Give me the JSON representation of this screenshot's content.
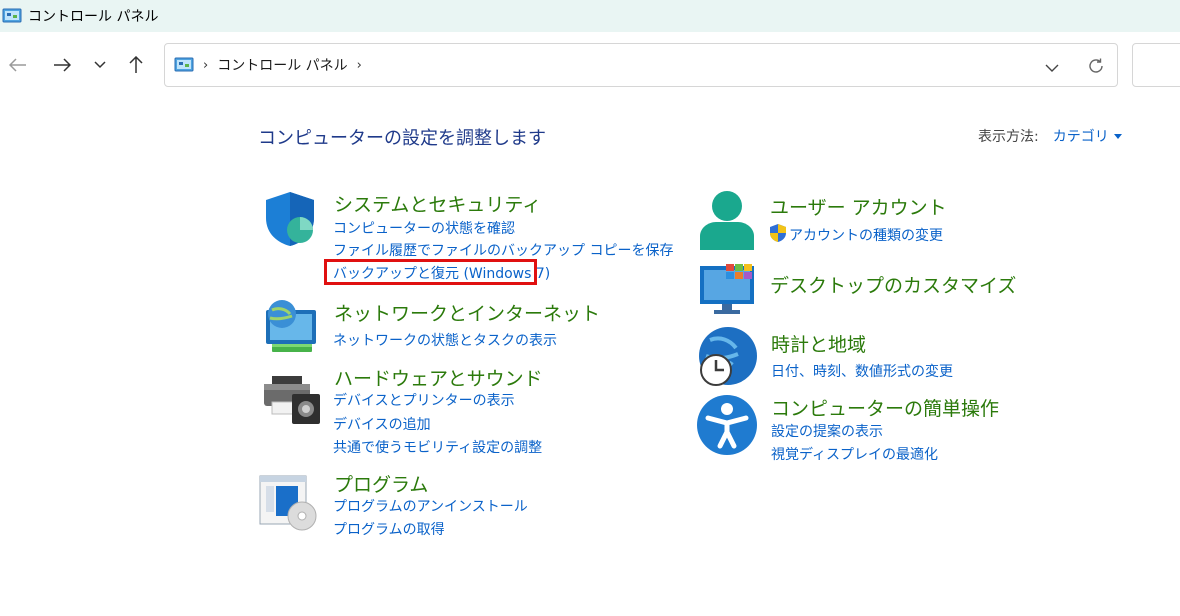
{
  "window": {
    "title": "コントロール パネル"
  },
  "address_bar": {
    "crumb": "コントロール パネル",
    "separator": "›"
  },
  "main": {
    "heading": "コンピューターの設定を調整します",
    "view_by_label": "表示方法:",
    "view_by_value": "カテゴリ"
  },
  "categories": [
    {
      "title": "システムとセキュリティ",
      "icon": "shield-icon",
      "links": [
        "コンピューターの状態を確認",
        "ファイル履歴でファイルのバックアップ コピーを保存",
        "バックアップと復元 (Windows 7)"
      ]
    },
    {
      "title": "ネットワークとインターネット",
      "icon": "network-globe-icon",
      "links": [
        "ネットワークの状態とタスクの表示"
      ]
    },
    {
      "title": "ハードウェアとサウンド",
      "icon": "printer-speaker-icon",
      "links": [
        "デバイスとプリンターの表示",
        "デバイスの追加",
        "共通で使うモビリティ設定の調整"
      ]
    },
    {
      "title": "プログラム",
      "icon": "programs-disc-icon",
      "links": [
        "プログラムのアンインストール",
        "プログラムの取得"
      ]
    },
    {
      "title": "ユーザー アカウント",
      "icon": "user-account-icon",
      "links": [
        "アカウントの種類の変更"
      ]
    },
    {
      "title": "デスクトップのカスタマイズ",
      "icon": "desktop-monitor-icon",
      "links": []
    },
    {
      "title": "時計と地域",
      "icon": "clock-globe-icon",
      "links": [
        "日付、時刻、数値形式の変更"
      ]
    },
    {
      "title": "コンピューターの簡単操作",
      "icon": "accessibility-icon",
      "links": [
        "設定の提案の表示",
        "視覚ディスプレイの最適化"
      ]
    }
  ],
  "colors": {
    "category_title": "#2b7a0b",
    "link": "#0a62c9",
    "heading": "#1f3a8a",
    "highlight": "#e01010"
  }
}
